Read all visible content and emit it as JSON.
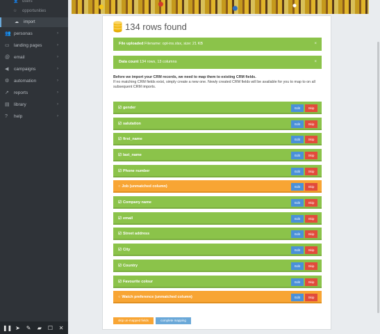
{
  "sidebar": {
    "sub_items": [
      {
        "label": "users",
        "icon": "users-icon"
      },
      {
        "label": "opportunities",
        "icon": "opportunities-icon"
      },
      {
        "label": "import",
        "icon": "import-icon"
      }
    ],
    "items": [
      {
        "label": "personas",
        "icon": "users-icon"
      },
      {
        "label": "landing pages",
        "icon": "pages-icon"
      },
      {
        "label": "email",
        "icon": "email-icon"
      },
      {
        "label": "campaigns",
        "icon": "megaphone-icon"
      },
      {
        "label": "automation",
        "icon": "gear-icon"
      },
      {
        "label": "reports",
        "icon": "chart-icon"
      },
      {
        "label": "library",
        "icon": "folder-icon"
      },
      {
        "label": "help",
        "icon": "question-icon"
      }
    ]
  },
  "page": {
    "title": "134 rows found",
    "alerts": [
      {
        "label": "File uploaded",
        "text": "Filename: opt-ins.xlsx, size: 21 KB"
      },
      {
        "label": "Data count",
        "text": "134 rows, 13 columns"
      }
    ],
    "intro_bold": "Before we import your CRM records, we need to map them to existing CRM fields.",
    "intro_text": "If no matching CRM fields exist, simply create a new one. Newly created CRM fields will be available for you to map to on all subsequent CRM imports."
  },
  "fields": [
    {
      "label": "gender",
      "status": "matched"
    },
    {
      "label": "salutation",
      "status": "matched"
    },
    {
      "label": "first_name",
      "status": "matched"
    },
    {
      "label": "last_name",
      "status": "matched"
    },
    {
      "label": "Phone number",
      "status": "matched"
    },
    {
      "label": "Job (unmatched column)",
      "status": "unmatched"
    },
    {
      "label": "Company name",
      "status": "matched"
    },
    {
      "label": "email",
      "status": "matched"
    },
    {
      "label": "Street address",
      "status": "matched"
    },
    {
      "label": "City",
      "status": "matched"
    },
    {
      "label": "Country",
      "status": "matched"
    },
    {
      "label": "Favourite colour",
      "status": "matched"
    },
    {
      "label": "Watch preference (unmatched column)",
      "status": "unmatched"
    }
  ],
  "buttons": {
    "edit": "Edit",
    "skip": "Skip",
    "skip_unmapped": "skip un-mapped fields",
    "complete_mapping": "complete mapping"
  },
  "toolbar": {
    "pause": "❚❚",
    "pointer": "➤",
    "pen": "✎",
    "eraser": "▰",
    "rect": "☐",
    "close": "✕"
  },
  "colors": {
    "matched": "#8bc34a",
    "unmatched": "#f8a534",
    "edit": "#4a90d9",
    "skip": "#e24b3b"
  }
}
